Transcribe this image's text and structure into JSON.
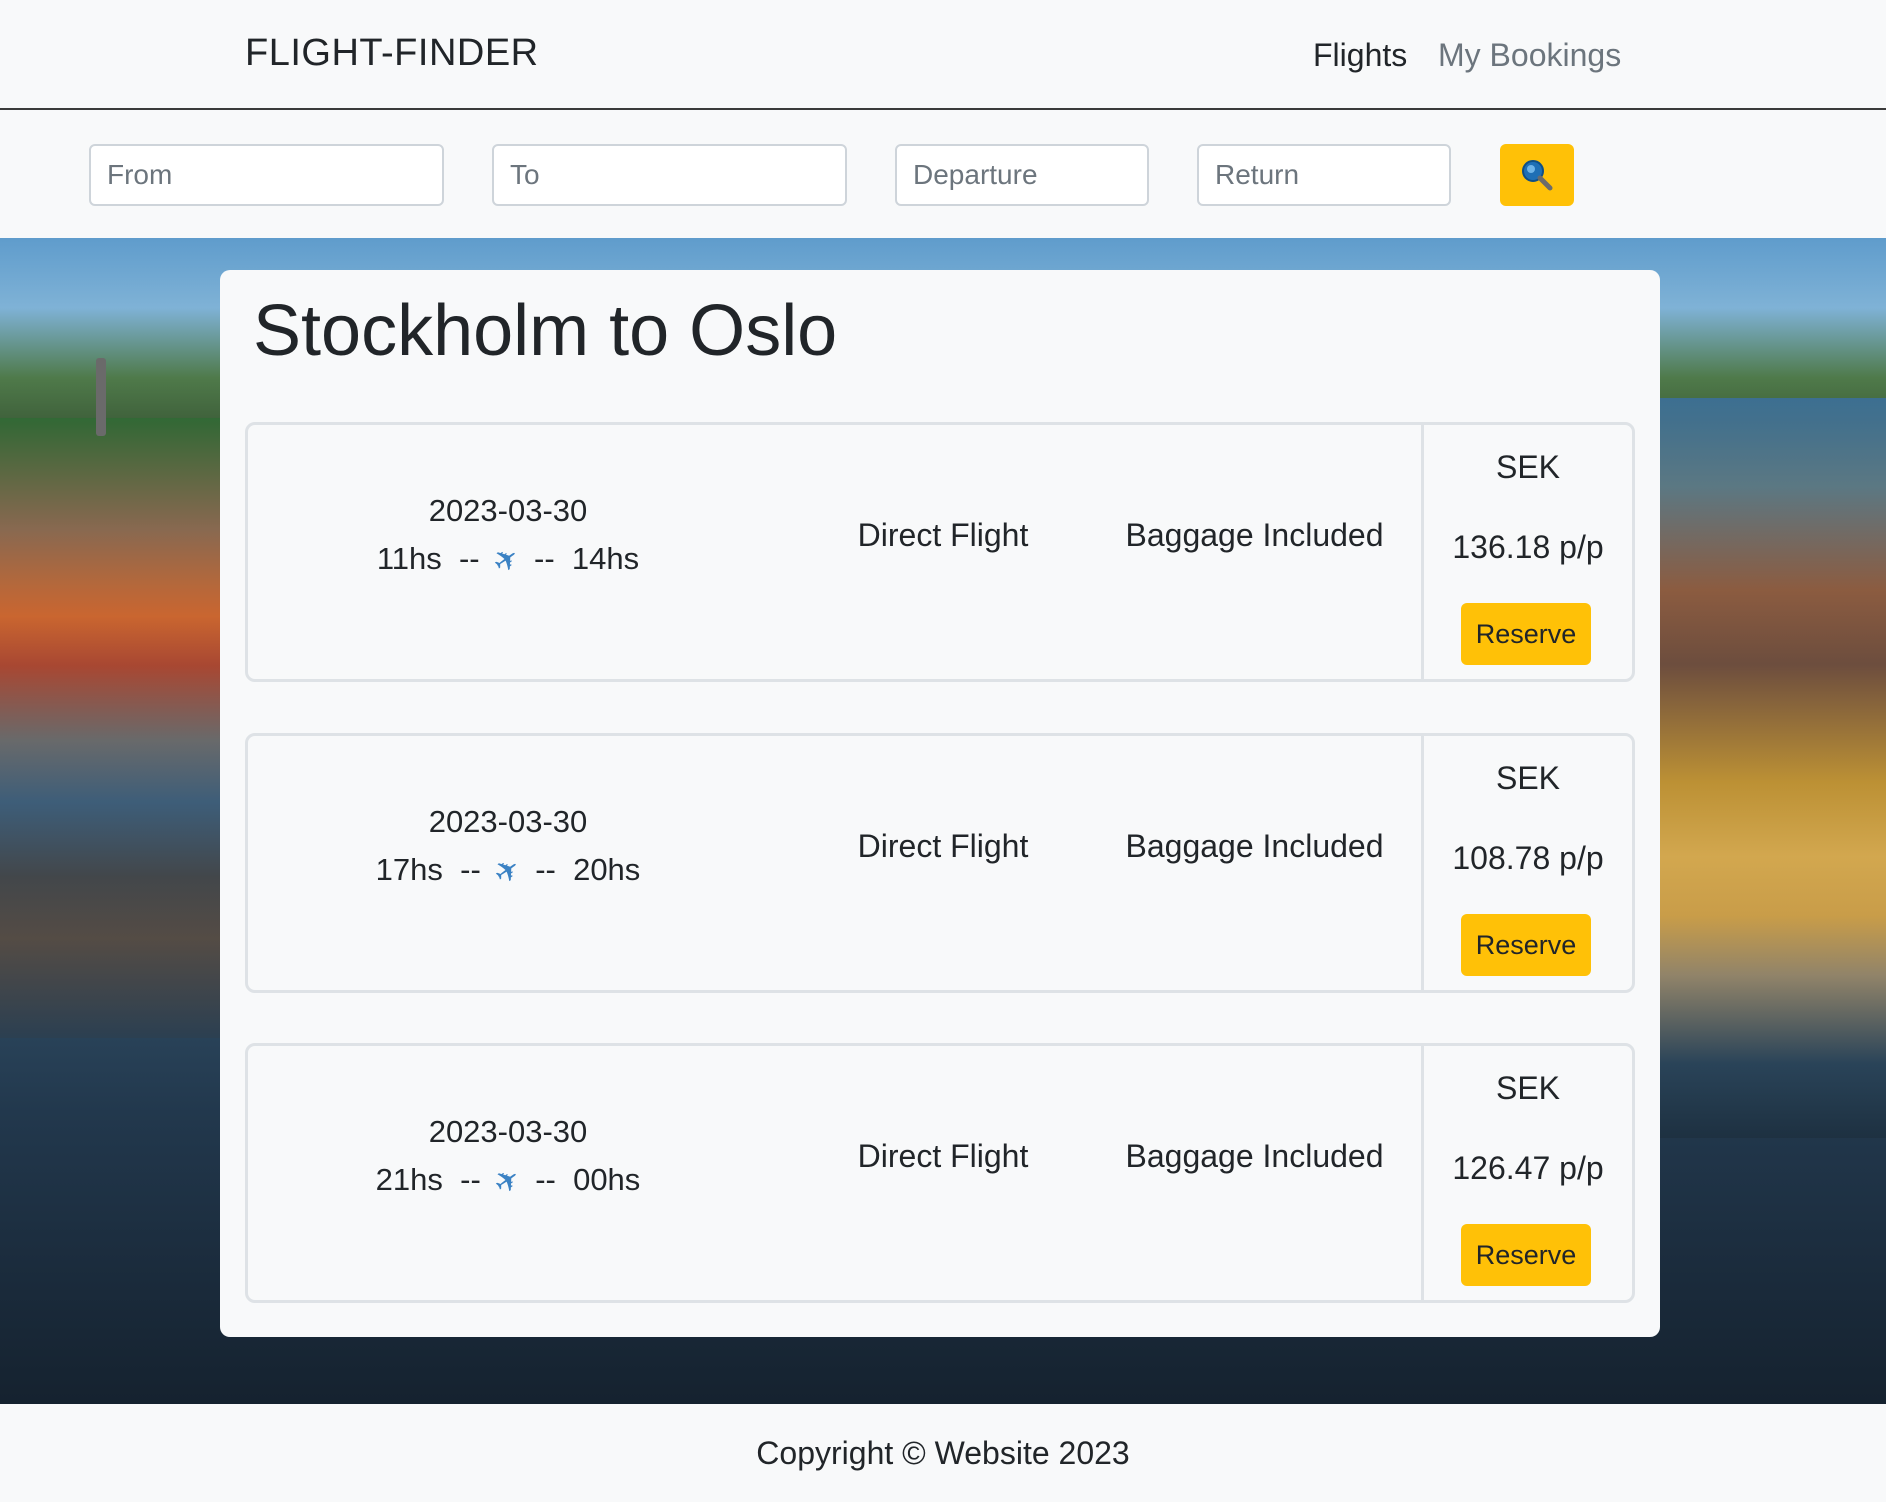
{
  "navbar": {
    "brand": "FLIGHT-FINDER",
    "links": {
      "flights": "Flights",
      "bookings": "My Bookings"
    }
  },
  "search": {
    "from_placeholder": "From",
    "to_placeholder": "To",
    "departure_placeholder": "Departure",
    "return_placeholder": "Return",
    "button_icon": "search-icon"
  },
  "main": {
    "title": "Stockholm to Oslo",
    "flights": [
      {
        "date": "2023-03-30",
        "depart": "11hs",
        "arrive": "14hs",
        "sep": "--",
        "type": "Direct Flight",
        "baggage": "Baggage Included",
        "currency": "SEK",
        "price": "136.18 p/p",
        "reserve_label": "Reserve"
      },
      {
        "date": "2023-03-30",
        "depart": "17hs",
        "arrive": "20hs",
        "sep": "--",
        "type": "Direct Flight",
        "baggage": "Baggage Included",
        "currency": "SEK",
        "price": "108.78 p/p",
        "reserve_label": "Reserve"
      },
      {
        "date": "2023-03-30",
        "depart": "21hs",
        "arrive": "00hs",
        "sep": "--",
        "type": "Direct Flight",
        "baggage": "Baggage Included",
        "currency": "SEK",
        "price": "126.47 p/p",
        "reserve_label": "Reserve"
      }
    ]
  },
  "footer": {
    "text": "Copyright © Website 2023"
  },
  "colors": {
    "accent": "#ffc107",
    "text": "#212529",
    "muted": "#6c757d",
    "border": "#dee2e6"
  }
}
